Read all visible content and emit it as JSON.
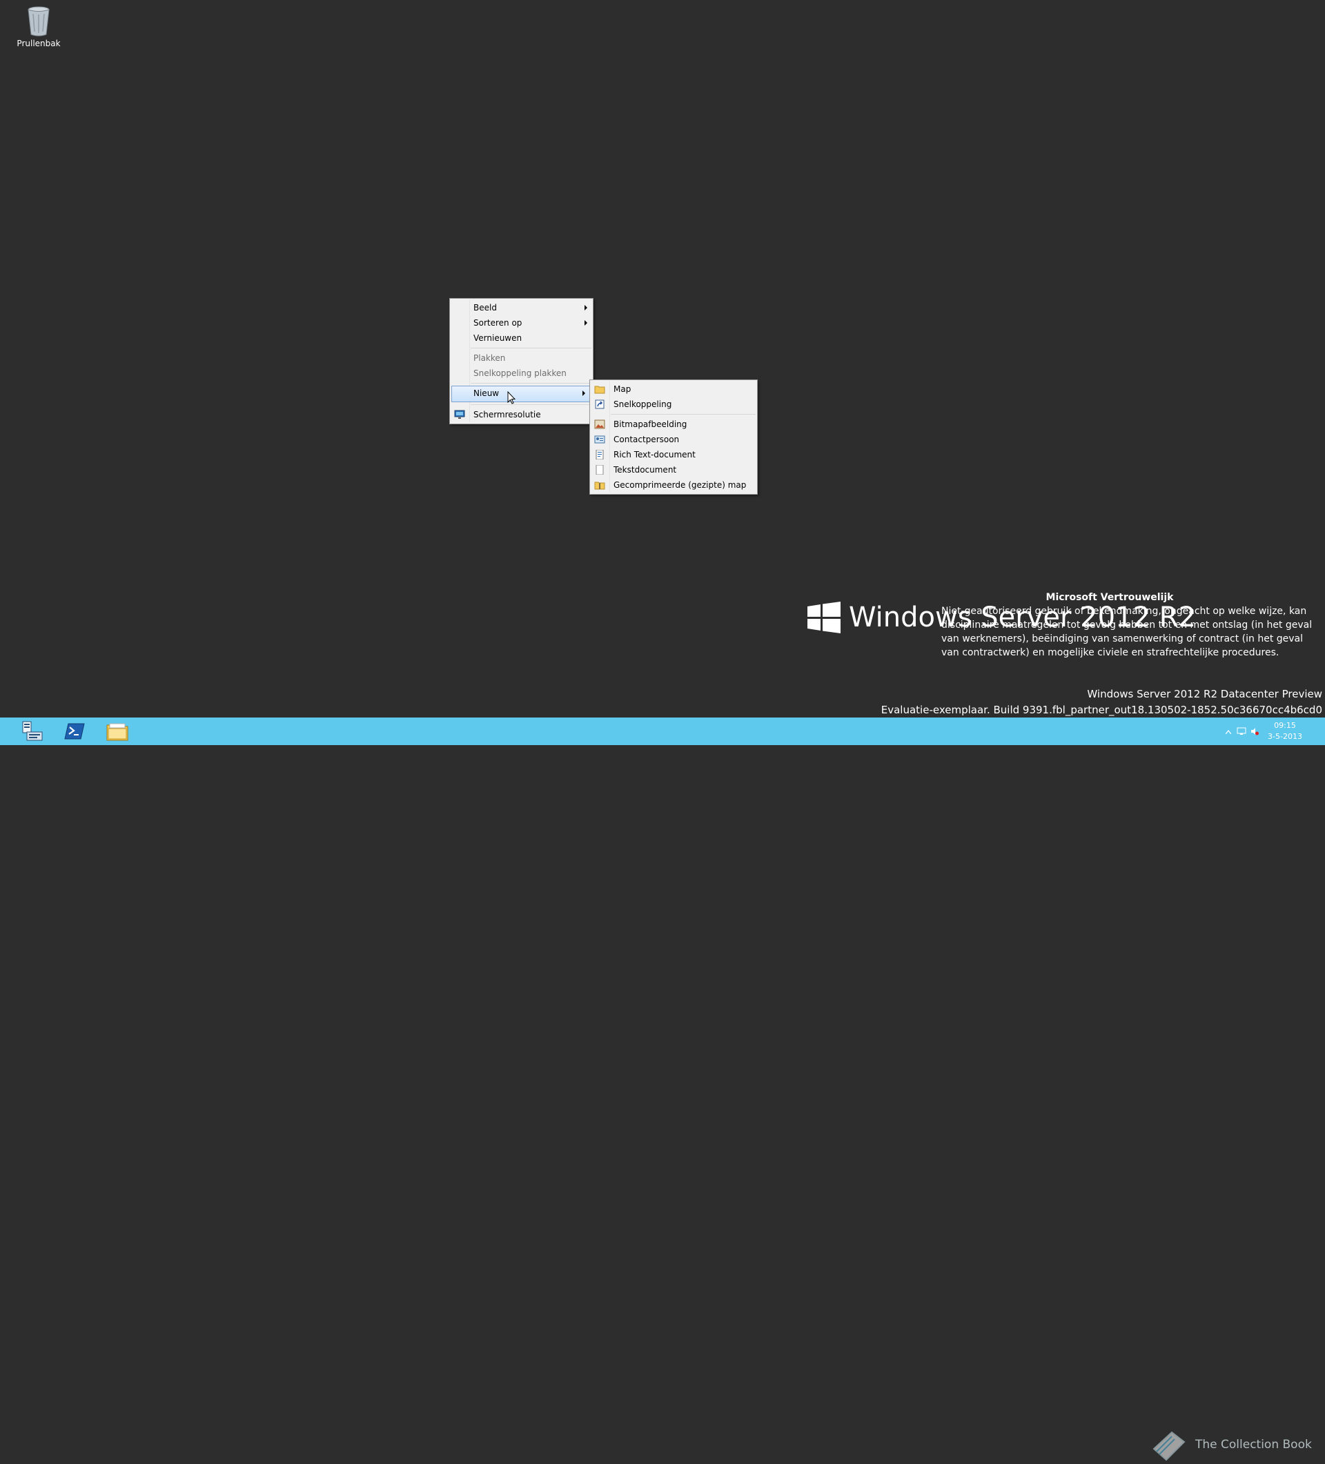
{
  "desktop": {
    "recycle_bin_label": "Prullenbak"
  },
  "context_menu": {
    "items": [
      {
        "label": "Beeld",
        "submenu": true,
        "disabled": false
      },
      {
        "label": "Sorteren op",
        "submenu": true,
        "disabled": false
      },
      {
        "label": "Vernieuwen",
        "submenu": false,
        "disabled": false
      },
      {
        "label": "Plakken",
        "submenu": false,
        "disabled": true
      },
      {
        "label": "Snelkoppeling plakken",
        "submenu": false,
        "disabled": true
      },
      {
        "label": "Nieuw",
        "submenu": true,
        "disabled": false,
        "highlighted": true
      },
      {
        "label": "Schermresolutie",
        "submenu": false,
        "disabled": false,
        "icon": "monitor-icon"
      }
    ]
  },
  "new_submenu": {
    "items": [
      {
        "label": "Map",
        "icon": "folder-icon"
      },
      {
        "label": "Snelkoppeling",
        "icon": "shortcut-icon"
      },
      {
        "label": "Bitmapafbeelding",
        "icon": "bitmap-icon"
      },
      {
        "label": "Contactpersoon",
        "icon": "contact-icon"
      },
      {
        "label": "Rich Text-document",
        "icon": "rtf-document-icon"
      },
      {
        "label": "Tekstdocument",
        "icon": "text-document-icon"
      },
      {
        "label": "Gecomprimeerde (gezipte) map",
        "icon": "zip-folder-icon"
      }
    ]
  },
  "watermark": {
    "brand": "Windows Server 2012 R2"
  },
  "confidential": {
    "title": "Microsoft Vertrouwelijk",
    "body": "Niet-geautoriseerd gebruik of bekendmaking, ongeacht op welke wijze, kan disciplinaire maatregelen tot gevolg hebben tot en met ontslag (in het geval van werknemers), beëindiging van samenwerking of contract (in het geval van contractwerk) en mogelijke civiele en strafrechtelijke procedures."
  },
  "build": {
    "edition": "Windows Server 2012 R2 Datacenter Preview",
    "evaluation": "Evaluatie-exemplaar. Build 9391.fbl_partner_out18.130502-1852.50c36670cc4b6cd0"
  },
  "taskbar": {
    "apps": [
      "server-manager-icon",
      "powershell-icon",
      "file-explorer-icon"
    ],
    "clock_time": "09:15",
    "clock_date": "3-5-2013",
    "overlay_text": "The Collection Book"
  },
  "colors": {
    "desktop": "#2d2d2d",
    "taskbar": "#5ec9ec",
    "menu_bg": "#f0f0f0",
    "highlight": "#c9e1fb"
  }
}
